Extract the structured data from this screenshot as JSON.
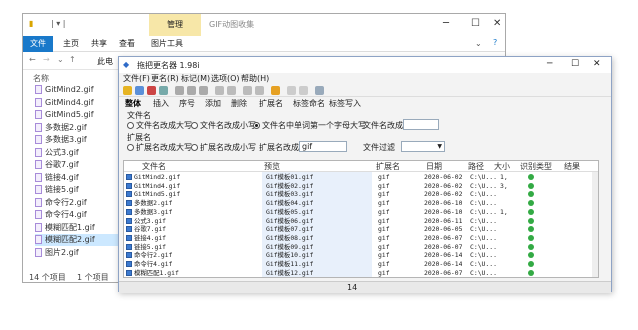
{
  "explorer": {
    "title_path": "| ▾ |",
    "manage_tab": "管理",
    "gif_tab_title": "GIF动图收集",
    "ribbon": [
      "文件",
      "主页",
      "共享",
      "查看",
      "图片工具"
    ],
    "address": "此电",
    "column_name": "名称",
    "files": [
      "GitMind2.gif",
      "GitMind4.gif",
      "GitMind5.gif",
      "多数据2.gif",
      "多数据3.gif",
      "公式3.gif",
      "谷歌7.gif",
      "链接4.gif",
      "链接5.gif",
      "命令行2.gif",
      "命令行4.gif",
      "模糊匹配1.gif",
      "模糊匹配2.gif",
      "图片2.gif"
    ],
    "status": "14 个项目",
    "status2": "1 个项目"
  },
  "renamer": {
    "title": "拖把更名器 1.98i",
    "menus": [
      "文件(F)",
      "更名(R)",
      "标记(M)",
      "选项(O)",
      "帮助(H)"
    ],
    "tabs": [
      "整体",
      "插入",
      "序号",
      "添加",
      "删除",
      "扩展名",
      "标签命名",
      "标签写入"
    ],
    "filename_label": "文件名",
    "opt_upper": "文件名改成大写",
    "opt_lower": "文件名改成小写",
    "opt_first": "文件名中单词第一个字母大写",
    "filename_change": "文件名改成",
    "ext_label": "扩展名",
    "ext_upper": "扩展名改成大写",
    "ext_lower": "扩展名改成小写",
    "ext_change": "扩展名改成",
    "ext_value": "gif",
    "file_filter": "文件过滤",
    "columns": [
      "文件名",
      "预览",
      "扩展名",
      "日期",
      "路径",
      "大小",
      "识别类型",
      "结果"
    ],
    "rows": [
      {
        "name": "GitMind2.gif",
        "new": "Gif模板01.gif",
        "ext": "gif",
        "date": "2020-06-02",
        "path": "C:\\U...",
        "size": "1,"
      },
      {
        "name": "GitMind4.gif",
        "new": "Gif模板02.gif",
        "ext": "gif",
        "date": "2020-06-02",
        "path": "C:\\U...",
        "size": "3,"
      },
      {
        "name": "GitMind5.gif",
        "new": "Gif模板03.gif",
        "ext": "gif",
        "date": "2020-06-02",
        "path": "C:\\U...",
        "size": ""
      },
      {
        "name": "多数据2.gif",
        "new": "Gif模板04.gif",
        "ext": "gif",
        "date": "2020-06-10",
        "path": "C:\\U...",
        "size": ""
      },
      {
        "name": "多数据3.gif",
        "new": "Gif模板05.gif",
        "ext": "gif",
        "date": "2020-06-10",
        "path": "C:\\U...",
        "size": "1,"
      },
      {
        "name": "公式3.gif",
        "new": "Gif模板06.gif",
        "ext": "gif",
        "date": "2020-06-11",
        "path": "C:\\U...",
        "size": ""
      },
      {
        "name": "谷歌7.gif",
        "new": "Gif模板07.gif",
        "ext": "gif",
        "date": "2020-06-05",
        "path": "C:\\U...",
        "size": ""
      },
      {
        "name": "链接4.gif",
        "new": "Gif模板08.gif",
        "ext": "gif",
        "date": "2020-06-07",
        "path": "C:\\U...",
        "size": ""
      },
      {
        "name": "链接5.gif",
        "new": "Gif模板09.gif",
        "ext": "gif",
        "date": "2020-06-07",
        "path": "C:\\U...",
        "size": ""
      },
      {
        "name": "命令行2.gif",
        "new": "Gif模板10.gif",
        "ext": "gif",
        "date": "2020-06-14",
        "path": "C:\\U...",
        "size": ""
      },
      {
        "name": "命令行4.gif",
        "new": "Gif模板11.gif",
        "ext": "gif",
        "date": "2020-06-14",
        "path": "C:\\U...",
        "size": ""
      },
      {
        "name": "模糊匹配1.gif",
        "new": "Gif模板12.gif",
        "ext": "gif",
        "date": "2020-06-07",
        "path": "C:\\U...",
        "size": ""
      }
    ],
    "status_count": "14"
  }
}
